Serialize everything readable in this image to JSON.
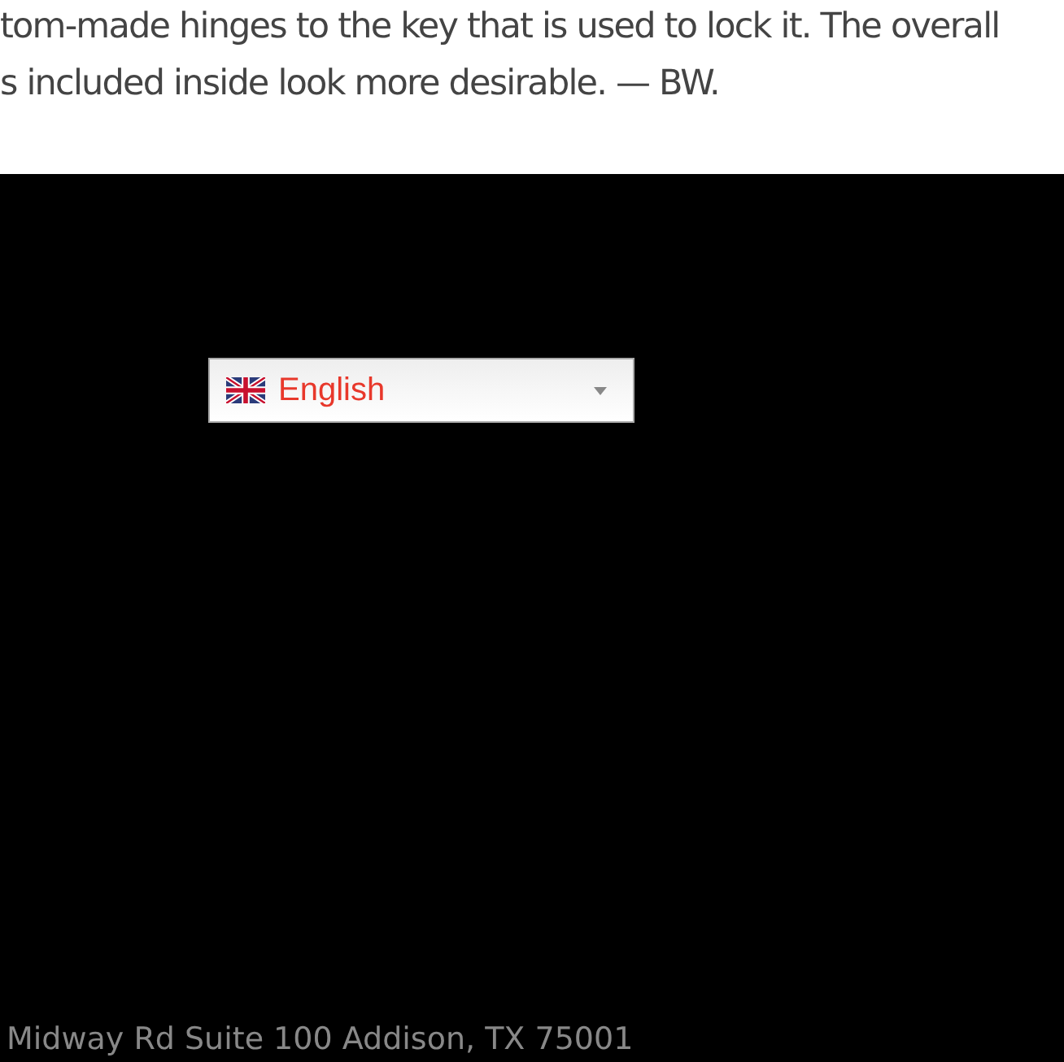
{
  "article": {
    "lines": [
      "tom-made hinges to the key that is used to lock it. The overall",
      "s included inside look more desirable. — BW."
    ]
  },
  "language_select": {
    "value": "English"
  },
  "footer": {
    "address": "Midway Rd Suite 100 Addison, TX 75001"
  }
}
